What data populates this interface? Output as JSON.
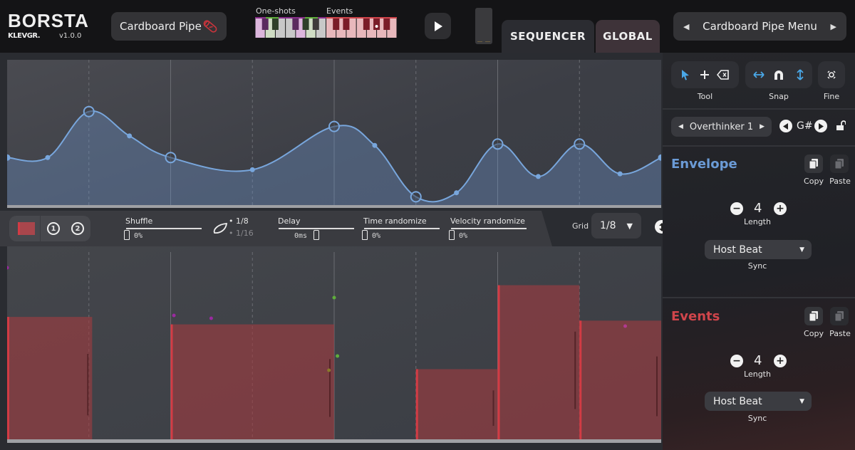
{
  "header": {
    "app_name": "BORSTA",
    "brand": "KLEVGR.",
    "version": "v1.0.0",
    "preset_name": "Cardboard Pipe",
    "keyboard": {
      "label_oneshots": "One-shots",
      "label_events": "Events"
    },
    "tabs": [
      {
        "label": "SEQUENCER",
        "active": true
      },
      {
        "label": "GLOBAL",
        "active": false
      }
    ],
    "menu_label": "Cardboard Pipe Menu"
  },
  "controls": {
    "shuffle": {
      "label": "Shuffle",
      "value": "0%",
      "level": 0
    },
    "shuffle_res": {
      "option1": "1/8",
      "option2": "1/16",
      "selected": "1/8"
    },
    "delay": {
      "label": "Delay",
      "value": "0ms",
      "level": 0.5
    },
    "time_randomize": {
      "label": "Time randomize",
      "value": "0%",
      "level": 0
    },
    "velocity_randomize": {
      "label": "Velocity randomize",
      "value": "0%",
      "level": 0
    },
    "grid": {
      "label": "Grid",
      "value": "1/8"
    },
    "pattern_buttons": [
      "1",
      "2"
    ]
  },
  "sidebar": {
    "tool_label": "Tool",
    "snap_label": "Snap",
    "fine_label": "Fine",
    "pattern_name": "Overthinker 1",
    "key_note": "G#",
    "envelope": {
      "title": "Envelope",
      "copy": "Copy",
      "paste": "Paste",
      "length": "4",
      "length_label": "Length",
      "sync_value": "Host Beat",
      "sync_label": "Sync",
      "color": "#6b9bd6"
    },
    "events": {
      "title": "Events",
      "copy": "Copy",
      "paste": "Paste",
      "length": "4",
      "length_label": "Length",
      "sync_value": "Host Beat",
      "sync_label": "Sync",
      "color": "#d0454b"
    }
  },
  "envelope_points": [
    {
      "x": 0.0,
      "y": 0.33,
      "type": "small"
    },
    {
      "x": 0.062,
      "y": 0.33,
      "type": "small"
    },
    {
      "x": 0.125,
      "y": 0.67,
      "type": "node"
    },
    {
      "x": 0.187,
      "y": 0.49,
      "type": "small"
    },
    {
      "x": 0.25,
      "y": 0.33,
      "type": "node"
    },
    {
      "x": 0.375,
      "y": 0.24,
      "type": "small"
    },
    {
      "x": 0.5,
      "y": 0.56,
      "type": "node"
    },
    {
      "x": 0.562,
      "y": 0.42,
      "type": "small"
    },
    {
      "x": 0.625,
      "y": 0.04,
      "type": "node"
    },
    {
      "x": 0.687,
      "y": 0.07,
      "type": "small"
    },
    {
      "x": 0.75,
      "y": 0.43,
      "type": "node"
    },
    {
      "x": 0.812,
      "y": 0.19,
      "type": "small"
    },
    {
      "x": 0.875,
      "y": 0.43,
      "type": "node"
    },
    {
      "x": 0.937,
      "y": 0.21,
      "type": "small"
    },
    {
      "x": 1.0,
      "y": 0.33,
      "type": "small"
    }
  ],
  "events_bars": [
    {
      "start": 0.0,
      "end": 0.13,
      "velocity": 0.66
    },
    {
      "start": 0.25,
      "end": 0.5,
      "velocity": 0.62
    },
    {
      "start": 0.625,
      "end": 0.75,
      "velocity": 0.38
    },
    {
      "start": 0.75,
      "end": 0.875,
      "velocity": 0.83
    },
    {
      "start": 0.875,
      "end": 1.0,
      "velocity": 0.64
    }
  ]
}
